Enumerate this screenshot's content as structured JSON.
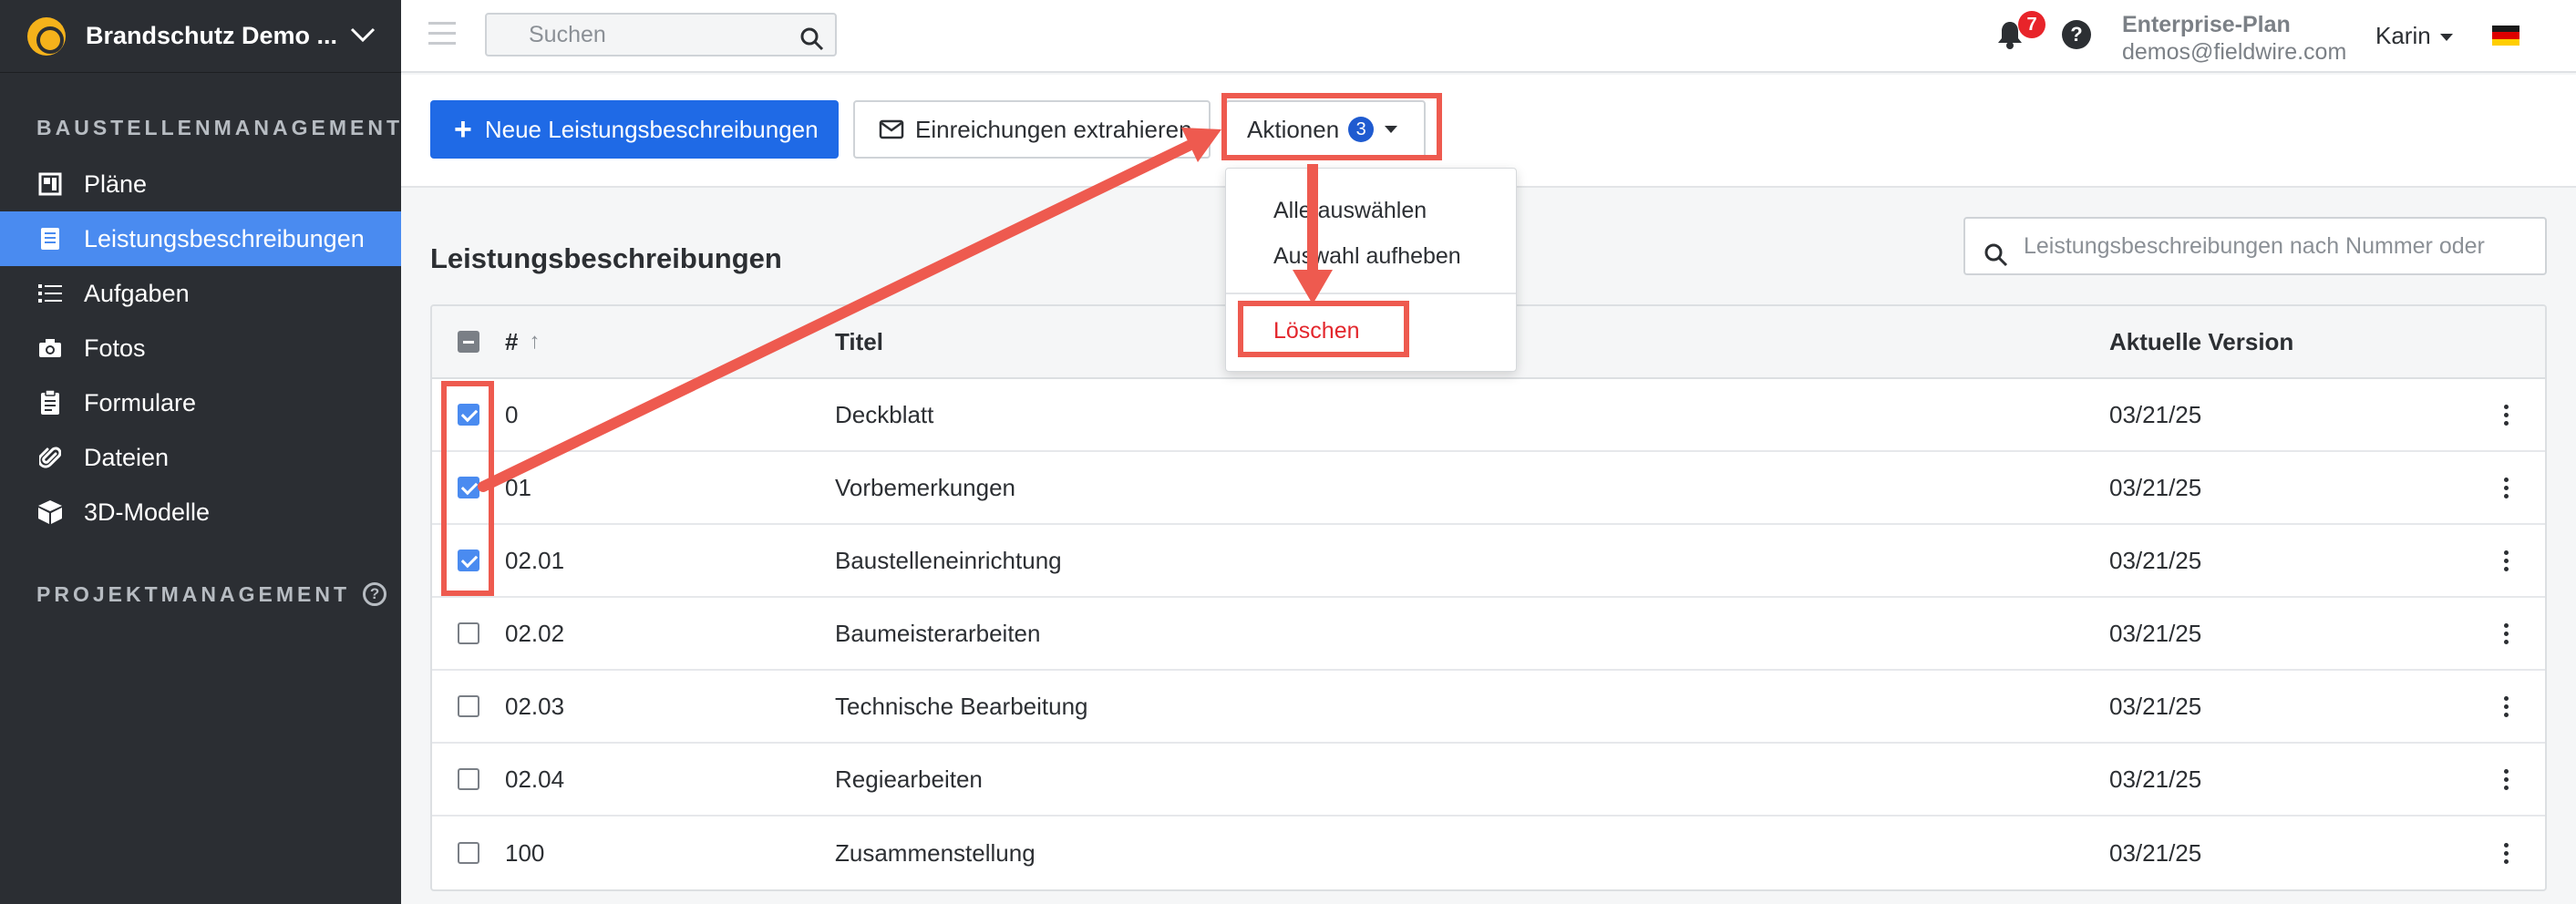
{
  "sidebar": {
    "project_name": "Brandschutz Demo ...",
    "section1": "BAUSTELLENMANAGEMENT",
    "section2": "PROJEKTMANAGEMENT",
    "items": [
      {
        "label": "Pläne",
        "icon": "plans-icon"
      },
      {
        "label": "Leistungsbeschreibungen",
        "icon": "specifications-icon"
      },
      {
        "label": "Aufgaben",
        "icon": "tasks-icon"
      },
      {
        "label": "Fotos",
        "icon": "camera-icon"
      },
      {
        "label": "Formulare",
        "icon": "forms-icon"
      },
      {
        "label": "Dateien",
        "icon": "paperclip-icon"
      },
      {
        "label": "3D-Modelle",
        "icon": "cube-icon"
      }
    ]
  },
  "topbar": {
    "search_placeholder": "Suchen",
    "notification_count": "7",
    "help": "?",
    "plan_name": "Enterprise-Plan",
    "email": "demos@fieldwire.com",
    "user_name": "Karin"
  },
  "toolbar": {
    "new_label": "Neue Leistungsbeschreibungen",
    "extract_label": "Einreichungen extrahieren",
    "actions_label": "Aktionen",
    "actions_count": "3"
  },
  "dropdown": {
    "select_all": "Alle auswählen",
    "deselect": "Auswahl aufheben",
    "delete": "Löschen"
  },
  "list": {
    "title": "Leistungsbeschreibungen",
    "search_placeholder": "Leistungsbeschreibungen nach Nummer oder",
    "columns": {
      "number": "#",
      "title": "Titel",
      "version": "Aktuelle Version"
    },
    "rows": [
      {
        "number": "0",
        "title": "Deckblatt",
        "version": "03/21/25",
        "checked": true
      },
      {
        "number": "01",
        "title": "Vorbemerkungen",
        "version": "03/21/25",
        "checked": true
      },
      {
        "number": "02.01",
        "title": "Baustelleneinrichtung",
        "version": "03/21/25",
        "checked": true
      },
      {
        "number": "02.02",
        "title": "Baumeisterarbeiten",
        "version": "03/21/25",
        "checked": false
      },
      {
        "number": "02.03",
        "title": "Technische Bearbeitung",
        "version": "03/21/25",
        "checked": false
      },
      {
        "number": "02.04",
        "title": "Regiearbeiten",
        "version": "03/21/25",
        "checked": false
      },
      {
        "number": "100",
        "title": "Zusammenstellung",
        "version": "03/21/25",
        "checked": false
      }
    ]
  },
  "colors": {
    "primary": "#1f6ae6",
    "active_nav": "#4a8bf0",
    "highlight": "#ee5a4f",
    "delete": "#e3262c"
  }
}
